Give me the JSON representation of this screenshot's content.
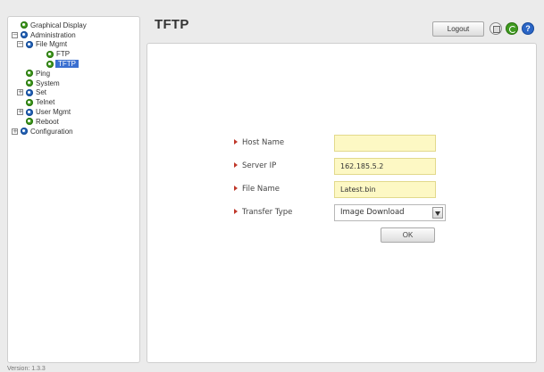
{
  "sidebar": {
    "items": [
      {
        "label": "Graphical Display",
        "toggle": "",
        "icon": "green",
        "indent": 0,
        "selected": false
      },
      {
        "label": "Administration",
        "toggle": "−",
        "icon": "blue",
        "indent": 0,
        "selected": false
      },
      {
        "label": "File Mgmt",
        "toggle": "−",
        "icon": "blue",
        "indent": 1,
        "selected": false
      },
      {
        "label": "FTP",
        "toggle": "",
        "icon": "green",
        "indent": 2,
        "selected": false
      },
      {
        "label": "TFTP",
        "toggle": "",
        "icon": "green",
        "indent": 2,
        "selected": true
      },
      {
        "label": "Ping",
        "toggle": "",
        "icon": "green",
        "indent": 1,
        "selected": false
      },
      {
        "label": "System",
        "toggle": "",
        "icon": "green",
        "indent": 1,
        "selected": false
      },
      {
        "label": "Set",
        "toggle": "+",
        "icon": "blue",
        "indent": 1,
        "selected": false
      },
      {
        "label": "Telnet",
        "toggle": "",
        "icon": "green",
        "indent": 1,
        "selected": false
      },
      {
        "label": "User Mgmt",
        "toggle": "+",
        "icon": "blue",
        "indent": 1,
        "selected": false
      },
      {
        "label": "Reboot",
        "toggle": "",
        "icon": "green",
        "indent": 1,
        "selected": false
      },
      {
        "label": "Configuration",
        "toggle": "+",
        "icon": "blue",
        "indent": 0,
        "selected": false
      }
    ]
  },
  "version": "Version: 1.3.3",
  "header": {
    "title": "TFTP",
    "logout_label": "Logout",
    "icons": [
      "save-icon",
      "refresh-icon",
      "help-icon"
    ],
    "help_glyph": "?"
  },
  "form": {
    "host_name": {
      "label": "Host Name",
      "value": ""
    },
    "server_ip": {
      "label": "Server IP",
      "value": "162.185.5.2"
    },
    "file_name": {
      "label": "File Name",
      "value": "Latest.bin"
    },
    "transfer_type": {
      "label": "Transfer Type",
      "value": "Image Download"
    },
    "ok_label": "OK"
  },
  "colors": {
    "input_bg": "#fdf8c4",
    "selected_bg": "#3a6fd0",
    "arrow": "#c0392b",
    "node_green": "#4ea72b",
    "node_blue": "#2f6fc4"
  }
}
